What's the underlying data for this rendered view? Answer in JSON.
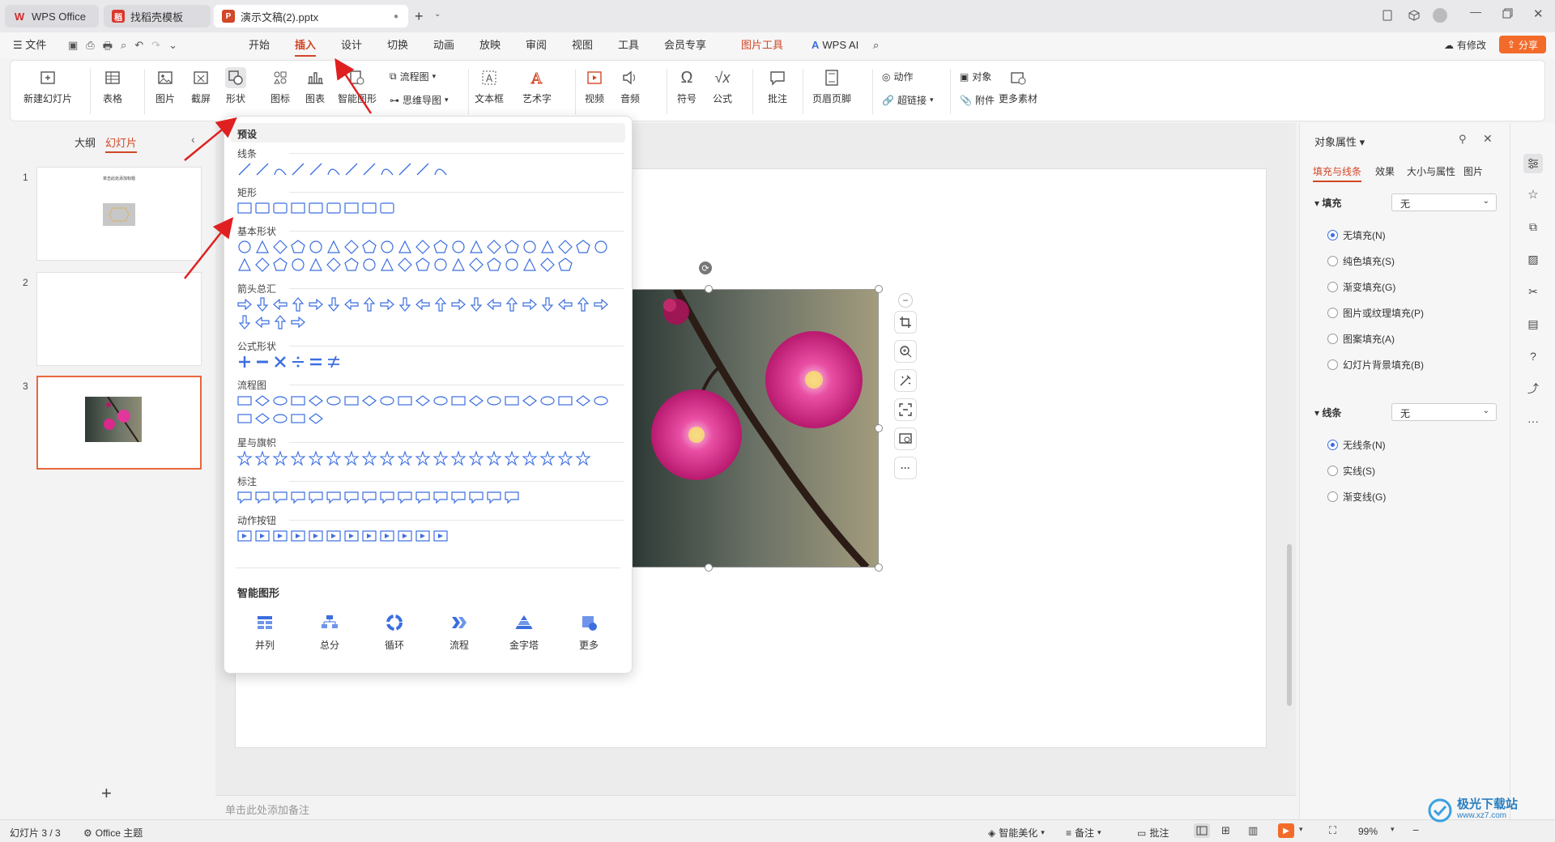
{
  "tabs": [
    {
      "label": "WPS Office",
      "icon": "wps-logo-icon"
    },
    {
      "label": "找稻壳模板",
      "icon": "docer-icon"
    },
    {
      "label": "演示文稿(2).pptx",
      "icon": "ppt-file-icon"
    }
  ],
  "menu": {
    "file": "文件",
    "items": [
      "开始",
      "插入",
      "设计",
      "切换",
      "动画",
      "放映",
      "审阅",
      "视图",
      "工具",
      "会员专享"
    ],
    "active": "插入",
    "picture_tools": "图片工具",
    "wps_ai": "WPS AI",
    "has_changes": "有修改",
    "share": "分享"
  },
  "ribbon": {
    "new_slide": "新建幻灯片",
    "table": "表格",
    "picture": "图片",
    "screenshot": "截屏",
    "shape": "形状",
    "icon": "图标",
    "chart": "图表",
    "smart_art": "智能图形",
    "flowchart": "流程图",
    "mindmap": "思维导图",
    "textbox": "文本框",
    "wordart": "艺术字",
    "video": "视频",
    "audio": "音频",
    "symbol": "符号",
    "formula": "公式",
    "comment": "批注",
    "header_footer": "页眉页脚",
    "action": "动作",
    "hyperlink": "超链接",
    "object": "对象",
    "attachment": "附件",
    "more_materials": "更多素材"
  },
  "left_pane": {
    "outline_tab": "大纲",
    "slides_tab": "幻灯片",
    "slides": [
      {
        "num": "1",
        "title": "单击此处添加标题"
      },
      {
        "num": "2"
      },
      {
        "num": "3"
      }
    ]
  },
  "dropdown": {
    "preset": "预设",
    "categories": [
      "线条",
      "矩形",
      "基本形状",
      "箭头总汇",
      "公式形状",
      "流程图",
      "星与旗帜",
      "标注",
      "动作按钮"
    ],
    "smart_title": "智能图形",
    "smart_items": [
      "并列",
      "总分",
      "循环",
      "流程",
      "金字塔",
      "更多"
    ]
  },
  "notes_placeholder": "单击此处添加备注",
  "right_panel": {
    "title": "对象属性",
    "tabs": [
      "填充与线条",
      "效果",
      "大小与属性",
      "图片"
    ],
    "fill_label": "填充",
    "fill_value": "无",
    "fill_options": [
      "无填充(N)",
      "纯色填充(S)",
      "渐变填充(G)",
      "图片或纹理填充(P)",
      "图案填充(A)",
      "幻灯片背景填充(B)"
    ],
    "line_label": "线条",
    "line_value": "无",
    "line_options": [
      "无线条(N)",
      "实线(S)",
      "渐变线(G)"
    ]
  },
  "status": {
    "slide_count": "幻灯片 3 / 3",
    "theme": "Office 主题",
    "beautify": "智能美化",
    "notes": "备注",
    "comments": "批注",
    "zoom": "99%"
  },
  "watermark": {
    "text": "极光下载站",
    "url": "www.xz7.com"
  },
  "colors": {
    "accent": "#d24726",
    "selection": "#e8673c",
    "share_bg": "#f26b2a",
    "radio_blue": "#3b6ee0",
    "annotation_arrow": "#e02020"
  }
}
